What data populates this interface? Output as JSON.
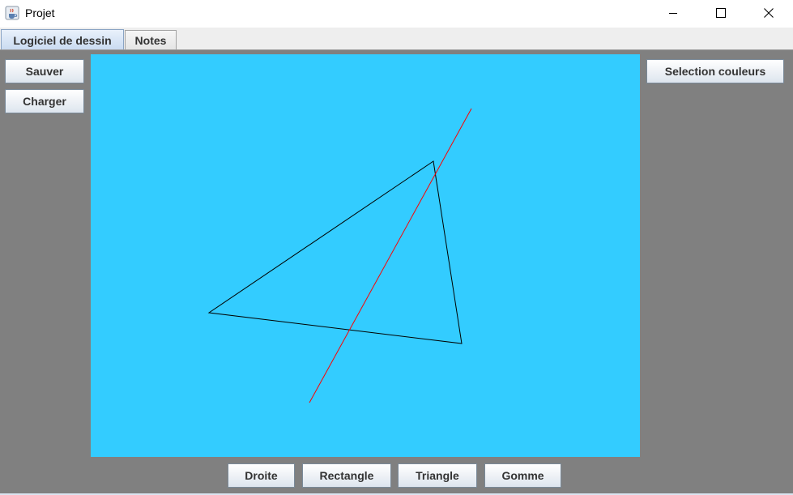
{
  "window": {
    "title": "Projet",
    "app_icon": "java-cup-icon",
    "controls": [
      "minimize-icon",
      "maximize-icon",
      "close-icon"
    ]
  },
  "tabs": [
    {
      "label": "Logiciel de dessin",
      "active": true
    },
    {
      "label": "Notes",
      "active": false
    }
  ],
  "left_panel": {
    "save_label": "Sauver",
    "load_label": "Charger"
  },
  "right_panel": {
    "color_label": "Selection couleurs"
  },
  "tools": {
    "line_label": "Droite",
    "rect_label": "Rectangle",
    "triangle_label": "Triangle",
    "eraser_label": "Gomme"
  },
  "colors": {
    "canvas_background": "#33ccff",
    "panel_background": "#808080",
    "triangle_stroke": "#000000",
    "line_stroke": "#ff0000"
  }
}
